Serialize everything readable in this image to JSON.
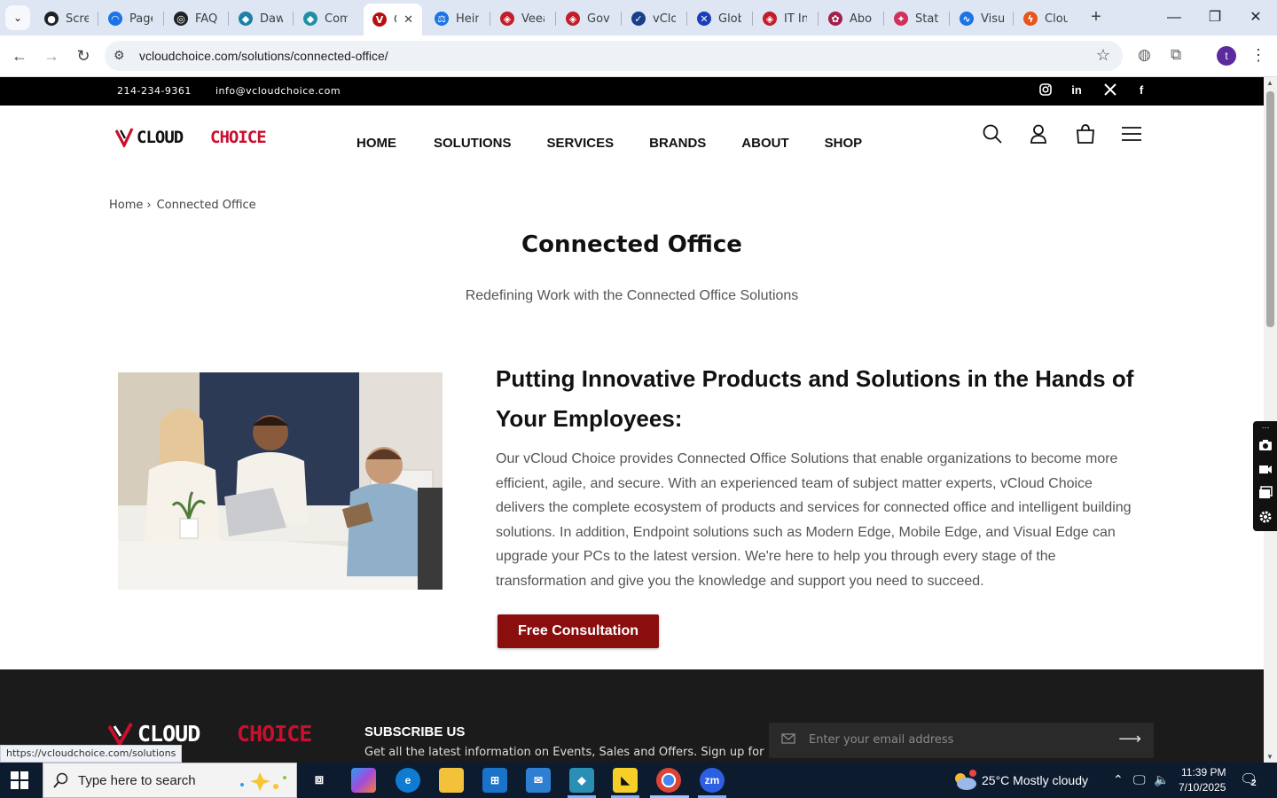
{
  "browser": {
    "tabs": [
      {
        "label": "Scree",
        "fav_color": "#202124",
        "fav_glyph": "●"
      },
      {
        "label": "Page",
        "fav_color": "#1a73e8",
        "fav_glyph": "◠"
      },
      {
        "label": "FAQ",
        "fav_color": "#202124",
        "fav_glyph": "◎"
      },
      {
        "label": "Dawo",
        "fav_color": "#1f7fa8",
        "fav_glyph": "◆"
      },
      {
        "label": "Com",
        "fav_color": "#1f8fa8",
        "fav_glyph": "◆"
      },
      {
        "label": "C",
        "fav_color": "#b80f0f",
        "fav_glyph": "V",
        "active": true
      },
      {
        "label": "Heim",
        "fav_color": "#1a73e8",
        "fav_glyph": "⚖"
      },
      {
        "label": "Veea",
        "fav_color": "#c21d2a",
        "fav_glyph": "◈"
      },
      {
        "label": "Gove",
        "fav_color": "#c21d2a",
        "fav_glyph": "◈"
      },
      {
        "label": "vClou",
        "fav_color": "#1a3f8a",
        "fav_glyph": "✓"
      },
      {
        "label": "Glob",
        "fav_color": "#1a3fb8",
        "fav_glyph": "✕"
      },
      {
        "label": "IT Inf",
        "fav_color": "#c21d2a",
        "fav_glyph": "◈"
      },
      {
        "label": "Abou",
        "fav_color": "#a0204a",
        "fav_glyph": "✿"
      },
      {
        "label": "Statu",
        "fav_color": "#d0305a",
        "fav_glyph": "✦"
      },
      {
        "label": "Visu",
        "fav_color": "#1a73e8",
        "fav_glyph": "∿"
      },
      {
        "label": "Clou",
        "fav_color": "#e8541a",
        "fav_glyph": "ϟ"
      }
    ],
    "url": "vcloudchoice.com/solutions/connected-office/",
    "profile_initial": "t",
    "status_url": "https://vcloudchoice.com/solutions"
  },
  "topbar": {
    "phone": "214-234-9361",
    "email": "info@vcloudchoice.com",
    "social": [
      "instagram-icon",
      "linkedin-icon",
      "x-icon",
      "facebook-icon"
    ]
  },
  "nav": {
    "items": [
      "HOME",
      "SOLUTIONS",
      "SERVICES",
      "BRANDS",
      "ABOUT",
      "SHOP"
    ]
  },
  "breadcrumb": {
    "home": "Home",
    "current": "Connected Office"
  },
  "page": {
    "title": "Connected Office",
    "subtitle": "Redefining Work with the Connected Office Solutions",
    "heading": "Putting Innovative Products and Solutions in the Hands of Your Employees:",
    "body": "Our vCloud Choice provides Connected Office Solutions that enable organizations to become more efficient, agile, and secure. With an experienced team of subject matter experts, vCloud Choice delivers the complete ecosystem of products and services for connected office and intelligent building solutions. In addition, Endpoint solutions such as Modern Edge, Mobile Edge, and Visual Edge can upgrade your PCs to the latest version. We're here to help you through every stage of the transformation and give you the knowledge and support you need to succeed.",
    "cta": "Free Consultation"
  },
  "footer": {
    "subscribe_title": "SUBSCRIBE US",
    "subscribe_text": "Get all the latest information on Events, Sales and Offers. Sign up for",
    "email_placeholder": "Enter your email address"
  },
  "taskbar": {
    "search_placeholder": "Type here to search",
    "weather": "25°C  Mostly cloudy",
    "time": "11:39 PM",
    "date": "7/10/2025",
    "notif_count": "2"
  },
  "colors": {
    "brand_red": "#8b0e0e",
    "logo_red": "#c8102e",
    "tabbar": "#dfe6f3"
  }
}
